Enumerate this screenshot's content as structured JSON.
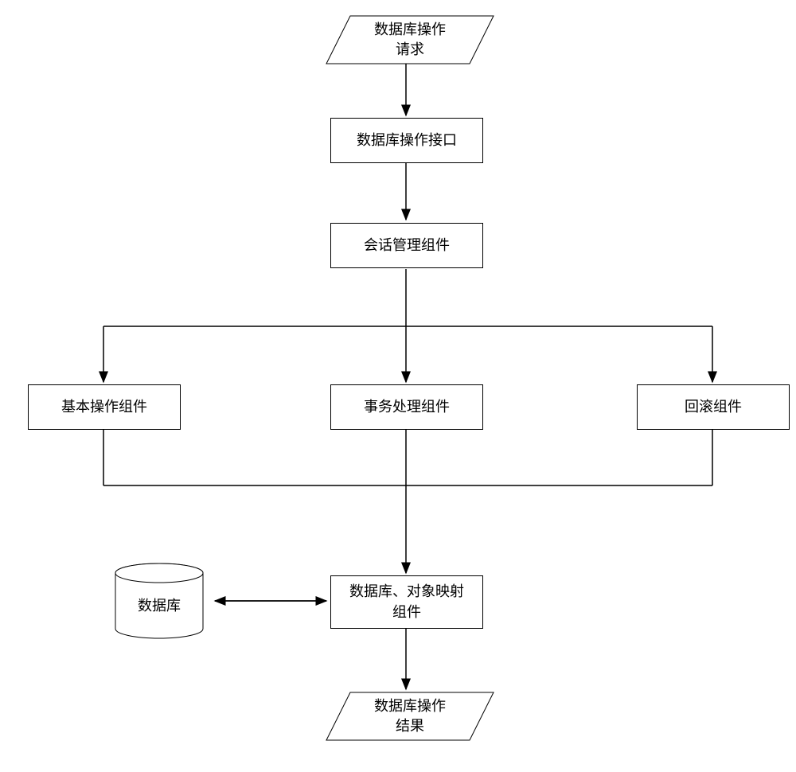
{
  "nodes": {
    "request": {
      "line1": "数据库操作",
      "line2": "请求"
    },
    "interface": "数据库操作接口",
    "session": "会话管理组件",
    "basic": "基本操作组件",
    "transaction": "事务处理组件",
    "rollback": "回滚组件",
    "database": "数据库",
    "mapping": {
      "line1": "数据库、对象映射",
      "line2": "组件"
    },
    "result": {
      "line1": "数据库操作",
      "line2": "结果"
    }
  }
}
